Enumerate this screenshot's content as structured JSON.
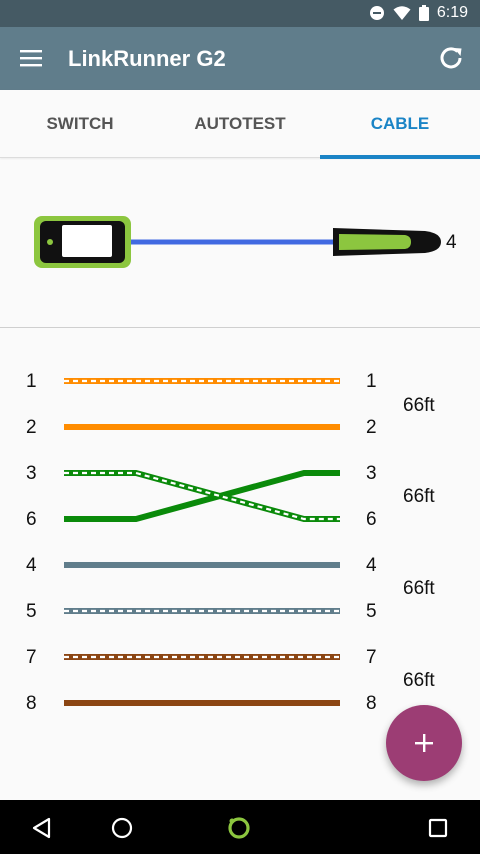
{
  "status_bar": {
    "time": "6:19"
  },
  "app_bar": {
    "title": "LinkRunner G2"
  },
  "tabs": [
    {
      "label": "SWITCH",
      "active": false
    },
    {
      "label": "AUTOTEST",
      "active": false
    },
    {
      "label": "CABLE",
      "active": true
    }
  ],
  "device": {
    "remote_id": "4"
  },
  "wiremap": {
    "left_pins": [
      "1",
      "2",
      "3",
      "6",
      "4",
      "5",
      "7",
      "8"
    ],
    "right_pins": [
      "1",
      "2",
      "3",
      "6",
      "4",
      "5",
      "7",
      "8"
    ],
    "pair_lengths": [
      "66ft",
      "66ft",
      "66ft",
      "66ft"
    ],
    "wire_colors": {
      "orange": "#ff8c00",
      "green": "#0a8a0a",
      "blue": "#607d8b",
      "brown": "#8b4513"
    }
  },
  "colors": {
    "accent": "#1a84c6",
    "app_bar": "#607d8b",
    "status_bar": "#455a64",
    "fab": "#9c3d74",
    "cable_line": "#4169e1",
    "device_green": "#8cc63f"
  }
}
